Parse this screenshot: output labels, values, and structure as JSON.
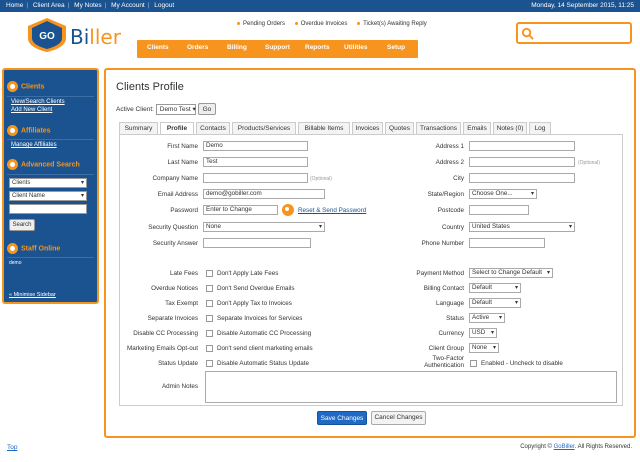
{
  "topbar": {
    "links": [
      "Home",
      "Client Area",
      "My Notes",
      "My Account",
      "Logout"
    ],
    "date": "Monday, 14 September 2015, 11:25"
  },
  "brand": {
    "logo_badge": "GO",
    "name_part1": "Bi",
    "name_part2": "ller"
  },
  "notices": [
    "Pending Orders",
    "Overdue Invoices",
    "Ticket(s) Awaiting Reply"
  ],
  "nav": [
    "Clients",
    "Orders",
    "Billing",
    "Support",
    "Reports",
    "Utilities",
    "Setup"
  ],
  "sidebar": {
    "clients_heading": "Clients",
    "clients_links": [
      "View/Search Clients",
      "Add New Client"
    ],
    "affiliates_heading": "Affiliates",
    "affiliates_links": [
      "Manage Affiliates"
    ],
    "search_heading": "Advanced Search",
    "search_type": "Clients",
    "search_field": "Client Name",
    "search_button": "Search",
    "staff_heading": "Staff Online",
    "staff_list": "demo",
    "minimise": "« Minimise Sidebar"
  },
  "main": {
    "title": "Clients Profile",
    "active_client_label": "Active Client:",
    "active_client_value": "Demo Test",
    "go_button": "Go",
    "tabs": [
      "Summary",
      "Profile",
      "Contacts",
      "Products/Services",
      "Billable Items",
      "Invoices",
      "Quotes",
      "Transactions",
      "Emails",
      "Notes (0)",
      "Log"
    ],
    "active_tab": "Profile"
  },
  "form": {
    "left": {
      "first_name": {
        "label": "First Name",
        "value": "Demo"
      },
      "last_name": {
        "label": "Last Name",
        "value": "Test"
      },
      "company_name": {
        "label": "Company Name",
        "value": "",
        "note": "(Optional)"
      },
      "email": {
        "label": "Email Address",
        "value": "demo@gobiller.com"
      },
      "password": {
        "label": "Password",
        "value": "Enter to Change",
        "link": "Reset & Send Password"
      },
      "security_question": {
        "label": "Security Question",
        "value": "None"
      },
      "security_answer": {
        "label": "Security Answer",
        "value": ""
      }
    },
    "right": {
      "address1": {
        "label": "Address 1",
        "value": ""
      },
      "address2": {
        "label": "Address 2",
        "value": "",
        "note": "(Optional)"
      },
      "city": {
        "label": "City",
        "value": ""
      },
      "state": {
        "label": "State/Region",
        "value": "Choose One..."
      },
      "postcode": {
        "label": "Postcode",
        "value": ""
      },
      "country": {
        "label": "Country",
        "value": "United States"
      },
      "phone": {
        "label": "Phone Number",
        "value": ""
      }
    },
    "checkboxes": [
      {
        "label": "Late Fees",
        "text": "Don't Apply Late Fees"
      },
      {
        "label": "Overdue Notices",
        "text": "Don't Send Overdue Emails"
      },
      {
        "label": "Tax Exempt",
        "text": "Don't Apply Tax to Invoices"
      },
      {
        "label": "Separate Invoices",
        "text": "Separate Invoices for Services"
      },
      {
        "label": "Disable CC Processing",
        "text": "Disable Automatic CC Processing"
      },
      {
        "label": "Marketing Emails Opt-out",
        "text": "Don't send client marketing emails"
      },
      {
        "label": "Status Update",
        "text": "Disable Automatic Status Update"
      }
    ],
    "selects_right": [
      {
        "label": "Payment Method",
        "value": "Select to Change Default"
      },
      {
        "label": "Billing Contact",
        "value": "Default"
      },
      {
        "label": "Language",
        "value": "Default"
      },
      {
        "label": "Status",
        "value": "Active"
      },
      {
        "label": "Currency",
        "value": "USD"
      },
      {
        "label": "Client Group",
        "value": "None"
      }
    ],
    "two_factor": {
      "label_line1": "Two-Factor",
      "label_line2": "Authentication",
      "text": "Enabled - Uncheck to disable"
    },
    "admin_notes_label": "Admin Notes"
  },
  "buttons": {
    "save": "Save Changes",
    "cancel": "Cancel Changes"
  },
  "footer": {
    "top": "Top",
    "copyright_prefix": "Copyright © ",
    "copyright_brand": "GoBiller",
    "copyright_suffix": ". All Rights Reserved."
  },
  "colors": {
    "primary": "#1a5390",
    "accent": "#f7941d",
    "button_blue": "#1f6ac4"
  }
}
